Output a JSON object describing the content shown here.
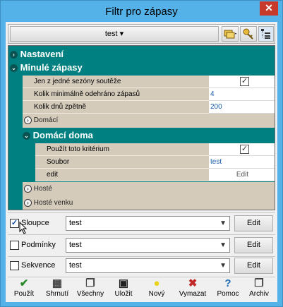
{
  "window": {
    "title": "Filtr pro zápasy",
    "close_glyph": "✕"
  },
  "toolbar": {
    "profile_label": "test ▾"
  },
  "tree": {
    "nastaveni": "Nastavení",
    "minule": "Minulé zápasy",
    "minule_props": [
      {
        "label": "Jen z jedné sezóny soutěže",
        "value": "✓",
        "kind": "check"
      },
      {
        "label": "Kolik minimálně odehráno zápasů",
        "value": "4",
        "kind": "text"
      },
      {
        "label": "Kolik dnů zpětně",
        "value": "200",
        "kind": "text"
      }
    ],
    "domaci": "Domácí",
    "domaci_doma": "Domácí doma",
    "domaci_doma_props": [
      {
        "label": "Použít toto kritérium",
        "value": "✓",
        "kind": "check"
      },
      {
        "label": "Soubor",
        "value": "test",
        "kind": "text"
      },
      {
        "label": "edit",
        "value": "Edit",
        "kind": "button"
      }
    ],
    "hoste": "Hosté",
    "hoste_venku": "Hosté venku"
  },
  "rows": [
    {
      "label": "Sloupce",
      "checked": "✓",
      "value": "test",
      "edit": "Edit"
    },
    {
      "label": "Podmínky",
      "checked": "",
      "value": "test",
      "edit": "Edit"
    },
    {
      "label": "Sekvence",
      "checked": "",
      "value": "test",
      "edit": "Edit"
    }
  ],
  "footer": [
    {
      "label": "Použít",
      "glyph": "✔",
      "color": "#2a8a2a"
    },
    {
      "label": "Shrnutí",
      "glyph": "▦",
      "color": "#444444"
    },
    {
      "label": "Všechny",
      "glyph": "❐",
      "color": "#444444"
    },
    {
      "label": "Uložit",
      "glyph": "▣",
      "color": "#222222"
    },
    {
      "label": "Nový",
      "glyph": "●",
      "color": "#e8d21a"
    },
    {
      "label": "Vymazat",
      "glyph": "✖",
      "color": "#c0282a"
    },
    {
      "label": "Pomoc",
      "glyph": "?",
      "color": "#1e6bb8"
    },
    {
      "label": "Archiv",
      "glyph": "❐",
      "color": "#444444"
    }
  ]
}
